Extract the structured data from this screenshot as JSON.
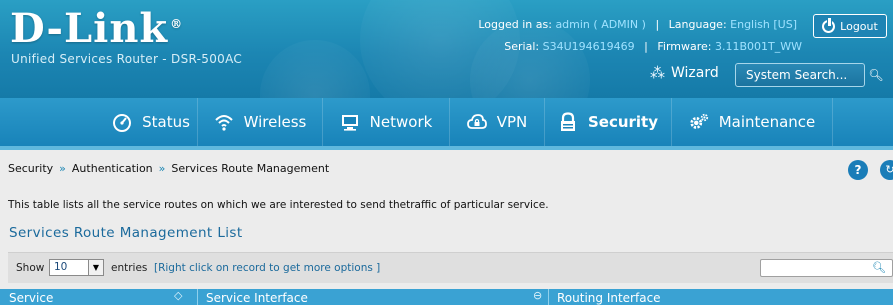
{
  "brand": {
    "logo": "D-Link",
    "registered": "®",
    "subtitle": "Unified Services Router - DSR-500AC"
  },
  "session": {
    "logged_in_label": "Logged in as:",
    "user": "admin ( ADMIN )",
    "language_label": "Language:",
    "language": "English [US]",
    "serial_label": "Serial:",
    "serial": "S34U194619469",
    "firmware_label": "Firmware:",
    "firmware": "3.11B001T_WW",
    "logout_label": "Logout",
    "separator": "|"
  },
  "toolbar": {
    "wizard_label": "Wizard",
    "search_placeholder": "System Search..."
  },
  "nav": {
    "items": [
      {
        "label": "Status",
        "icon": "dashboard-icon"
      },
      {
        "label": "Wireless",
        "icon": "wifi-icon"
      },
      {
        "label": "Network",
        "icon": "monitor-icon"
      },
      {
        "label": "VPN",
        "icon": "cloud-lock-icon"
      },
      {
        "label": "Security",
        "icon": "lock-icon",
        "active": true
      },
      {
        "label": "Maintenance",
        "icon": "gears-icon"
      }
    ]
  },
  "breadcrumb": {
    "items": [
      "Security",
      "Authentication",
      "Services Route Management"
    ],
    "separator": "»"
  },
  "help": {
    "label": "?"
  },
  "page": {
    "description": "This table lists all the service routes on which we are interested to send thetraffic of particular service.",
    "section_title": "Services Route Management List"
  },
  "table": {
    "show_label": "Show",
    "page_size": "10",
    "entries_label": "entries",
    "hint": "[Right click on record to get more options ]",
    "columns": [
      "Service",
      "Service Interface",
      "Routing Interface"
    ]
  },
  "colors": {
    "header": "#1c86b3",
    "nav": "#1883b9",
    "accent": "#3aa2d3",
    "title": "#1b6a9c"
  }
}
